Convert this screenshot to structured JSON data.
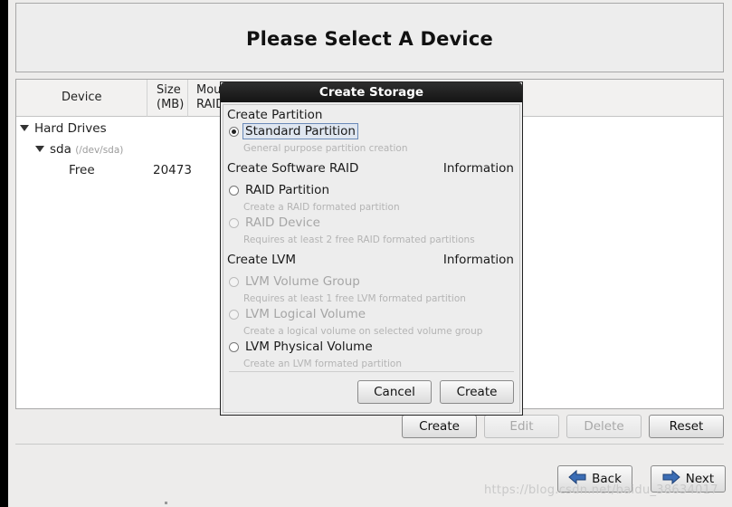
{
  "header": {
    "title": "Please Select A Device"
  },
  "table": {
    "columns": {
      "device": "Device",
      "size_line1": "Size",
      "size_line2": "(MB)",
      "mount_line1": "Mou",
      "mount_line2": "RAID"
    },
    "rows": {
      "hard_drives": "Hard Drives",
      "sda_name": "sda",
      "sda_path": "(/dev/sda)",
      "free_name": "Free",
      "free_size": "20473"
    }
  },
  "toolbar": {
    "create": "Create",
    "edit": "Edit",
    "delete": "Delete",
    "reset": "Reset"
  },
  "nav": {
    "back": "Back",
    "next": "Next"
  },
  "watermark": "https://blog.csdn.net/baidu_38634017",
  "dialog": {
    "title": "Create Storage",
    "sections": {
      "partition": "Create Partition",
      "raid": "Create Software RAID",
      "raid_info": "Information",
      "lvm": "Create LVM",
      "lvm_info": "Information"
    },
    "options": {
      "standard": {
        "label": "Standard Partition",
        "desc": "General purpose partition creation"
      },
      "raid_partition": {
        "label": "RAID Partition",
        "desc": "Create a RAID formated partition"
      },
      "raid_device": {
        "label": "RAID Device",
        "desc": "Requires at least 2 free RAID formated partitions"
      },
      "lvm_vg": {
        "label": "LVM Volume Group",
        "desc": "Requires at least 1 free LVM formated partition"
      },
      "lvm_lv": {
        "label": "LVM Logical Volume",
        "desc": "Create a logical volume on selected volume group"
      },
      "lvm_pv": {
        "label": "LVM Physical Volume",
        "desc": "Create an LVM formated partition"
      }
    },
    "buttons": {
      "cancel": "Cancel",
      "create": "Create"
    }
  },
  "colors": {
    "dialog_titlebar": "#1e1e1e",
    "background": "#edeceb",
    "disabled_text": "#a8a8a8"
  },
  "icons": {
    "back": "arrow-left-icon",
    "next": "arrow-right-icon",
    "expander": "triangle-down-icon",
    "radio": "radio-icon"
  }
}
